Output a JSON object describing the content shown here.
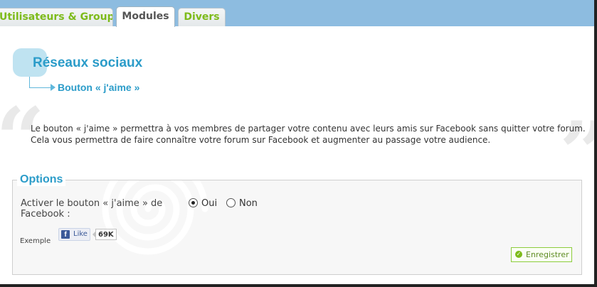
{
  "tabs": [
    {
      "label": "Utilisateurs & Groupes"
    },
    {
      "label": "Modules"
    },
    {
      "label": "Divers"
    }
  ],
  "heading": {
    "title": "Réseaux sociaux",
    "subtitle": "Bouton « j'aime »"
  },
  "description": {
    "line1": "Le bouton « j'aime » permettra à vos membres de partager votre contenu avec leurs amis sur Facebook sans quitter votre forum.",
    "line2": "Cela vous permettra de faire connaître votre forum sur Facebook et augmenter au passage votre audience."
  },
  "options": {
    "legend": "Options",
    "field_label": "Activer le bouton « j'aime » de Facebook :",
    "radio_oui": "Oui",
    "radio_non": "Non",
    "selected": "Oui",
    "example_label": "Exemple",
    "fb_like_label": "Like",
    "fb_count": "69K",
    "save_label": "Enregistrer"
  },
  "colors": {
    "tab_bar": "#8dbce0",
    "title_blue": "#2b9cc9",
    "tab_green": "#7dbb1a",
    "save_green": "#7dbb1a",
    "facebook_blue": "#3b5998"
  }
}
